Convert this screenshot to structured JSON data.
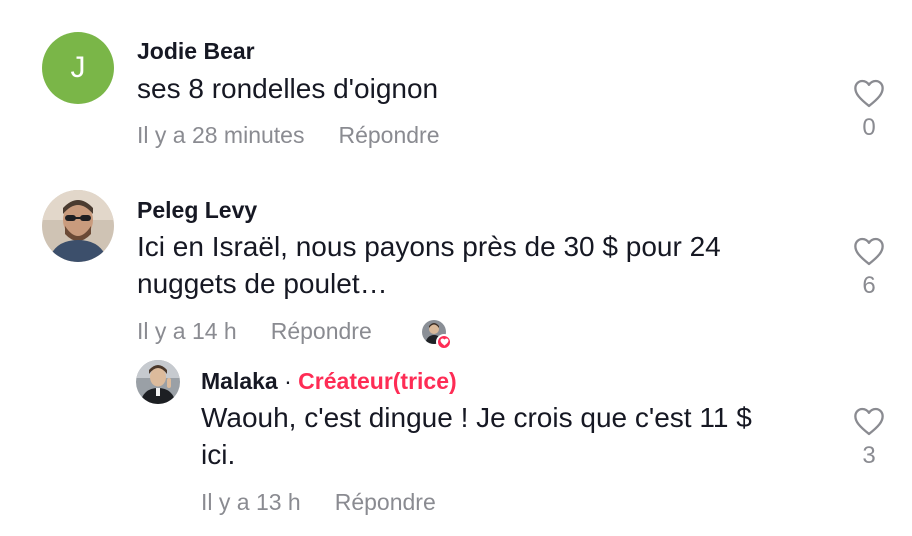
{
  "comments": [
    {
      "author": "Jodie Bear",
      "avatar_letter": "J",
      "text": "ses 8 rondelles d'oignon",
      "time": "Il y a 28 minutes",
      "reply_label": "Répondre",
      "likes": "0"
    },
    {
      "author": "Peleg Levy",
      "text_line1": "Ici en Israël, nous payons près de 30 $ pour 24",
      "text_line2": "nuggets de poulet…",
      "time": "Il y a 14 h",
      "reply_label": "Répondre",
      "likes": "6"
    }
  ],
  "reply": {
    "author": "Malaka",
    "separator": "·",
    "role": "Créateur(trice)",
    "text_line1": "Waouh, c'est dingue ! Je crois que c'est 11 $",
    "text_line2": "ici.",
    "time": "Il y a 13 h",
    "reply_label": "Répondre",
    "likes": "3"
  },
  "colors": {
    "creator_accent": "#fe2c55",
    "muted_text": "#8a8b91",
    "avatar_green": "#7ab648"
  },
  "icons": {
    "like": "heart-outline-icon",
    "creator_liked": "heart-badge-icon"
  }
}
